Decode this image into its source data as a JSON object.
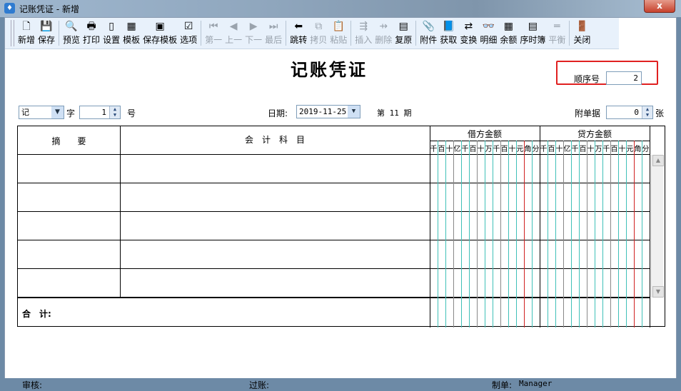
{
  "window": {
    "title": "记账凭证 - 新增",
    "close_label": "x"
  },
  "toolbar": [
    {
      "label": "新增",
      "icon": "new-doc-icon",
      "glyph": "🗋",
      "enabled": true
    },
    {
      "label": "保存",
      "icon": "save-icon",
      "glyph": "💾",
      "enabled": true
    },
    {
      "sep": true
    },
    {
      "label": "预览",
      "icon": "preview-icon",
      "glyph": "🔍",
      "enabled": true
    },
    {
      "label": "打印",
      "icon": "print-icon",
      "glyph": "🖶",
      "enabled": true
    },
    {
      "label": "设置",
      "icon": "page-setup-icon",
      "glyph": "▯",
      "enabled": true
    },
    {
      "label": "模板",
      "icon": "template-icon",
      "glyph": "▦",
      "enabled": true
    },
    {
      "label": "保存模板",
      "icon": "save-template-icon",
      "glyph": "▣",
      "enabled": true
    },
    {
      "label": "选项",
      "icon": "options-icon",
      "glyph": "☑",
      "enabled": true
    },
    {
      "sep": true
    },
    {
      "label": "第一",
      "icon": "first-icon",
      "glyph": "⏮",
      "enabled": false
    },
    {
      "label": "上一",
      "icon": "prev-icon",
      "glyph": "◀",
      "enabled": false
    },
    {
      "label": "下一",
      "icon": "next-icon",
      "glyph": "▶",
      "enabled": false
    },
    {
      "label": "最后",
      "icon": "last-icon",
      "glyph": "⏭",
      "enabled": false
    },
    {
      "sep": true
    },
    {
      "label": "跳转",
      "icon": "jump-icon",
      "glyph": "⬅",
      "enabled": true
    },
    {
      "label": "拷贝",
      "icon": "copy-icon",
      "glyph": "⧉",
      "enabled": false
    },
    {
      "label": "粘贴",
      "icon": "paste-icon",
      "glyph": "📋",
      "enabled": false
    },
    {
      "sep": true
    },
    {
      "label": "插入",
      "icon": "insert-row-icon",
      "glyph": "⇶",
      "enabled": false
    },
    {
      "label": "删除",
      "icon": "delete-row-icon",
      "glyph": "⇸",
      "enabled": false
    },
    {
      "label": "复原",
      "icon": "restore-icon",
      "glyph": "▤",
      "enabled": true
    },
    {
      "sep": true
    },
    {
      "label": "附件",
      "icon": "attachment-icon",
      "glyph": "📎",
      "enabled": true
    },
    {
      "label": "获取",
      "icon": "fetch-icon",
      "glyph": "📘",
      "enabled": true
    },
    {
      "label": "变换",
      "icon": "transform-icon",
      "glyph": "⇄",
      "enabled": true
    },
    {
      "label": "明细",
      "icon": "binoculars-icon",
      "glyph": "👓",
      "enabled": true
    },
    {
      "label": "余额",
      "icon": "balance-icon",
      "glyph": "▦",
      "enabled": true
    },
    {
      "label": "序时簿",
      "icon": "journal-icon",
      "glyph": "▤",
      "enabled": true
    },
    {
      "label": "平衡",
      "icon": "equal-icon",
      "glyph": "═",
      "enabled": false
    },
    {
      "sep": true
    },
    {
      "label": "关闭",
      "icon": "exit-door-icon",
      "glyph": "🚪",
      "enabled": true
    }
  ],
  "voucher": {
    "title": "记账凭证",
    "seq_label": "顺序号",
    "seq_value": "2",
    "word_value": "记",
    "word_label": "字",
    "number_value": "1",
    "number_label": "号",
    "date_label": "日期:",
    "date_value": "2019-11-25",
    "period_text": "第 11 期",
    "attach_label": "附单据",
    "attach_value": "0",
    "attach_unit": "张"
  },
  "table": {
    "col_summary": "摘　　要",
    "col_account": "会　计　科　目",
    "col_debit": "借方金额",
    "col_credit": "贷方金额",
    "digit_units": [
      "千",
      "百",
      "十",
      "亿",
      "千",
      "百",
      "十",
      "万",
      "千",
      "百",
      "十",
      "元",
      "角",
      "分"
    ],
    "rows": [
      {
        "summary": "",
        "account": ""
      },
      {
        "summary": "",
        "account": ""
      },
      {
        "summary": "",
        "account": ""
      },
      {
        "summary": "",
        "account": ""
      },
      {
        "summary": "",
        "account": ""
      }
    ],
    "total_label": "合　计:"
  },
  "footer": {
    "review_label": "审核:",
    "review_value": "",
    "post_label": "过账:",
    "post_value": "",
    "maker_label": "制单:",
    "maker_value": "Manager"
  },
  "colors": {
    "grid_teal": "#40c0b8",
    "grid_red": "#d02020",
    "highlight": "#e02020"
  }
}
